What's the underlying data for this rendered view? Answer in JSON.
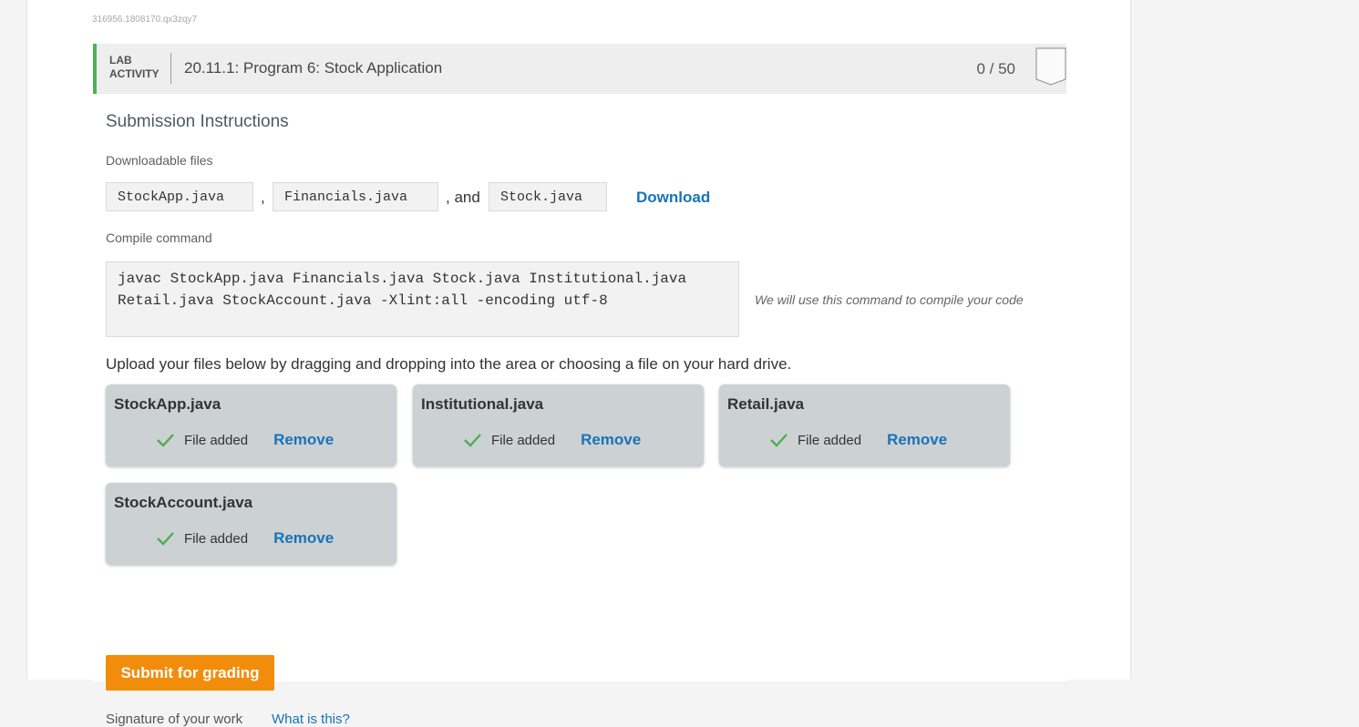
{
  "lab": {
    "id_text": "316956.1808170.qx3zqy7",
    "tag_line1": "LAB",
    "tag_line2": "ACTIVITY",
    "title": "20.11.1: Program 6: Stock Application",
    "score": "0 / 50",
    "accent_color": "#52b058"
  },
  "submission": {
    "heading": "Submission Instructions",
    "downloadable_label": "Downloadable files",
    "files": [
      "StockApp.java",
      "Financials.java",
      "Stock.java"
    ],
    "comma": ",",
    "and_text": ", and",
    "download_label": "Download",
    "compile_label": "Compile command",
    "compile_command": "javac StockApp.java Financials.java Stock.java Institutional.java Retail.java StockAccount.java -Xlint:all -encoding utf-8",
    "compile_note": "We will use this command to compile your code",
    "upload_instructions": "Upload your files below by dragging and dropping into the area or choosing a file on your hard drive."
  },
  "uploads": [
    {
      "name": "StockApp.java",
      "status": "File added",
      "remove": "Remove"
    },
    {
      "name": "Institutional.java",
      "status": "File added",
      "remove": "Remove"
    },
    {
      "name": "Retail.java",
      "status": "File added",
      "remove": "Remove"
    },
    {
      "name": "StockAccount.java",
      "status": "File added",
      "remove": "Remove"
    }
  ],
  "actions": {
    "submit_label": "Submit for grading",
    "submit_color": "#f28d0b",
    "signature_label": "Signature of your work",
    "what_is_this": "What is this?"
  }
}
